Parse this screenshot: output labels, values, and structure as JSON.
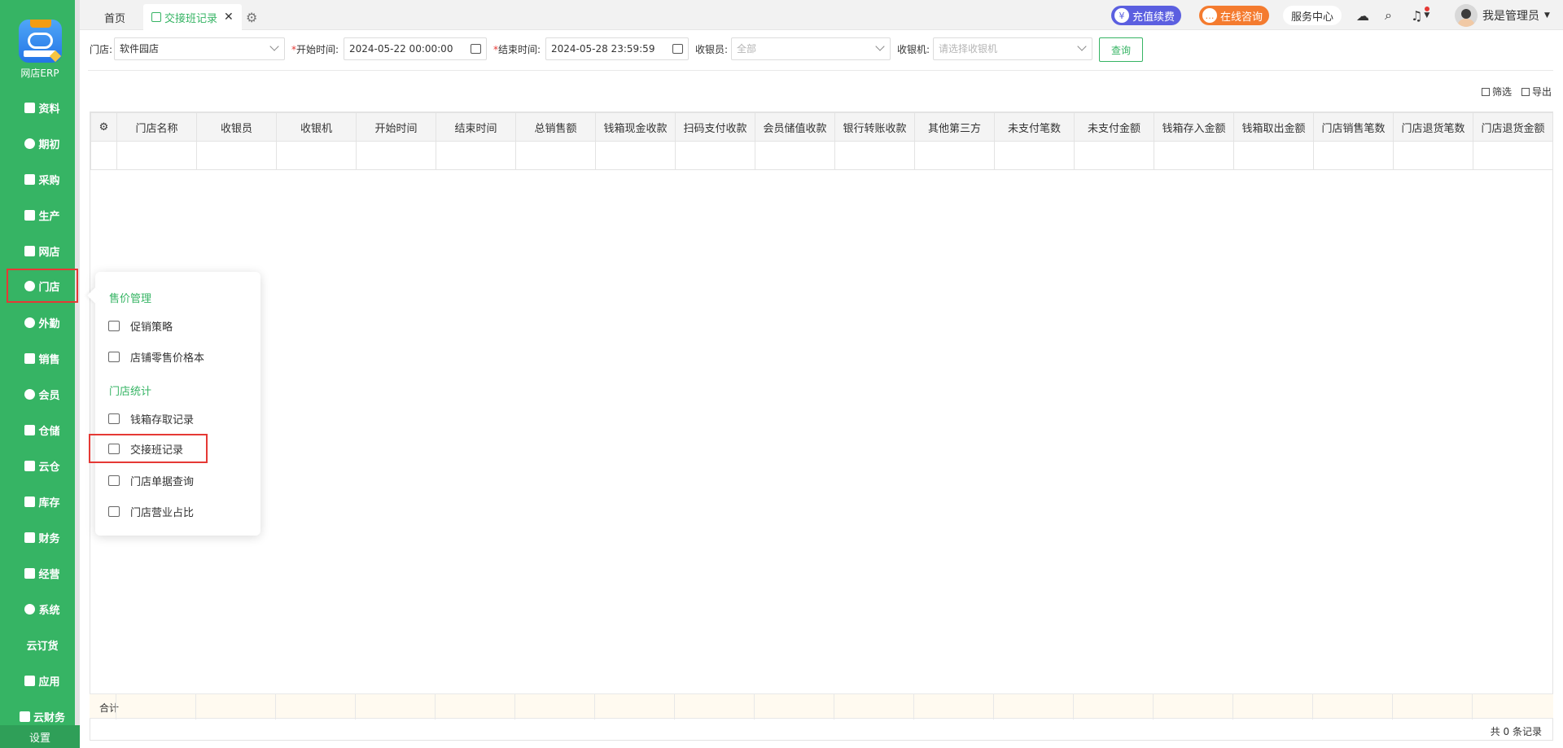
{
  "sidebar": {
    "logo_text": "网店ERP",
    "items": [
      {
        "label": "资料",
        "icon": "document-icon"
      },
      {
        "label": "期初",
        "icon": "target-icon"
      },
      {
        "label": "采购",
        "icon": "book-icon"
      },
      {
        "label": "生产",
        "icon": "factory-icon"
      },
      {
        "label": "网店",
        "icon": "store-icon"
      },
      {
        "label": "门店",
        "icon": "pie-icon",
        "active": true
      },
      {
        "label": "外勤",
        "icon": "compass-icon"
      },
      {
        "label": "销售",
        "icon": "chart-icon"
      },
      {
        "label": "会员",
        "icon": "pie-icon"
      },
      {
        "label": "仓储",
        "icon": "warehouse-icon"
      },
      {
        "label": "云仓",
        "icon": "cloud-warehouse-icon"
      },
      {
        "label": "库存",
        "icon": "home-icon"
      },
      {
        "label": "财务",
        "icon": "wallet-icon"
      },
      {
        "label": "经营",
        "icon": "briefcase-icon"
      },
      {
        "label": "系统",
        "icon": "gear-icon"
      },
      {
        "label": "云订货",
        "icon": ""
      },
      {
        "label": "应用",
        "icon": "plus-icon"
      },
      {
        "label": "云财务",
        "icon": "cloud-finance-icon"
      }
    ],
    "settings_label": "设置"
  },
  "tabs": {
    "home": "首页",
    "active": "交接班记录",
    "close_glyph": "✕",
    "gear_glyph": "⚙"
  },
  "header": {
    "recharge": "充值续费",
    "consult": "在线咨询",
    "service": "服务中心",
    "user": "我是管理员"
  },
  "filters": {
    "store_label": "门店:",
    "store_value": "软件园店",
    "start_label": "开始时间:",
    "start_value": "2024-05-22 00:00:00",
    "end_label": "结束时间:",
    "end_value": "2024-05-28 23:59:59",
    "cashier_label": "收银员:",
    "cashier_placeholder": "全部",
    "machine_label": "收银机:",
    "machine_placeholder": "请选择收银机",
    "query_button": "查询",
    "required_mark": "*"
  },
  "toolbar": {
    "filter": "筛选",
    "export": "导出"
  },
  "table": {
    "columns": [
      "门店名称",
      "收银员",
      "收银机",
      "开始时间",
      "结束时间",
      "总销售额",
      "钱箱现金收款",
      "扫码支付收款",
      "会员储值收款",
      "银行转账收款",
      "其他第三方",
      "未支付笔数",
      "未支付金额",
      "钱箱存入金额",
      "钱箱取出金额",
      "门店销售笔数",
      "门店退货笔数",
      "门店退货金额"
    ],
    "total_label": "合计",
    "record_count": "共 0 条记录"
  },
  "popup": {
    "section1": "售价管理",
    "section1_items": [
      "促销策略",
      "店铺零售价格本"
    ],
    "section2": "门店统计",
    "section2_items": [
      "钱箱存取记录",
      "交接班记录",
      "门店单据查询",
      "门店营业占比"
    ]
  },
  "colors": {
    "brand_green": "#36b464",
    "highlight_red": "#e53935"
  }
}
